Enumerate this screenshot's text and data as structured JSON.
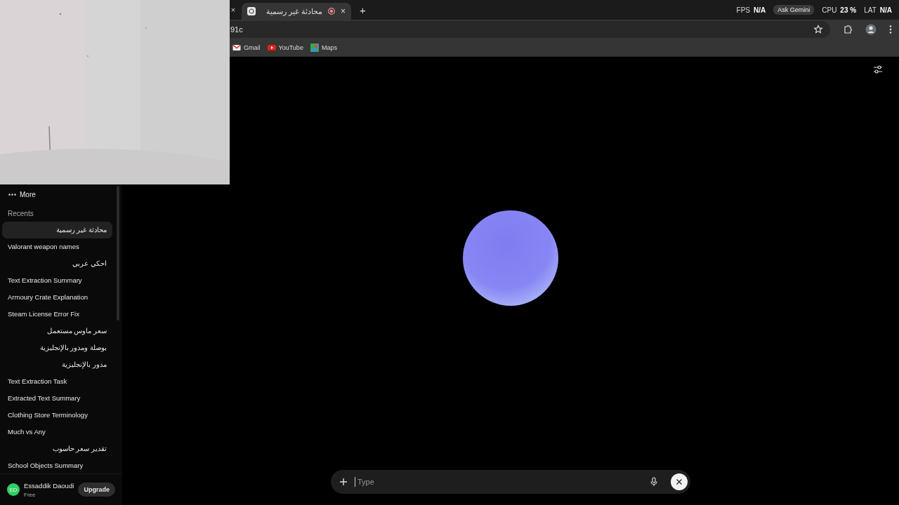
{
  "browser": {
    "prev_tab_close": "×",
    "tabs": [
      {
        "title": "محادثة غير رسمية",
        "recording": true,
        "selected": true,
        "close": "×"
      }
    ],
    "new_tab": "+",
    "address": "91c",
    "bookmarks": [
      {
        "kind": "gmail",
        "label": "Gmail"
      },
      {
        "kind": "youtube",
        "label": "YouTube"
      },
      {
        "kind": "maps",
        "label": "Maps"
      }
    ]
  },
  "overlay": {
    "stats": [
      {
        "label": "FPS",
        "value": "N/A"
      },
      {
        "label": "CPU",
        "value": "23 %"
      },
      {
        "label": "LAT",
        "value": "N/A"
      }
    ],
    "tooltip": "Ask Gemini"
  },
  "sidebar": {
    "more": "More",
    "recents_heading": "Recents",
    "recents": [
      {
        "title": "محادثة غير رسمية",
        "selected": true
      },
      {
        "title": "Valorant weapon names",
        "selected": false
      },
      {
        "title": "احكي عربي",
        "selected": false
      },
      {
        "title": "Text Extraction Summary",
        "selected": false
      },
      {
        "title": "Armoury Crate Explanation",
        "selected": false
      },
      {
        "title": "Steam License Error Fix",
        "selected": false
      },
      {
        "title": "سعر ماوس مستعمل",
        "selected": false
      },
      {
        "title": "بوصلة ومدور بالإنجليزية",
        "selected": false
      },
      {
        "title": "مدور بالإنجليزية",
        "selected": false
      },
      {
        "title": "Text Extraction Task",
        "selected": false
      },
      {
        "title": "Extracted Text Summary",
        "selected": false
      },
      {
        "title": "Clothing Store Terminology",
        "selected": false
      },
      {
        "title": "Much vs Any",
        "selected": false
      },
      {
        "title": "تقدير سعر حاسوب",
        "selected": false
      },
      {
        "title": "School Objects Summary",
        "selected": false
      }
    ],
    "user": {
      "initials": "ED",
      "name": "Essaddik Daoudi",
      "plan": "Free",
      "upgrade": "Upgrade"
    }
  },
  "composer": {
    "placeholder": "Type"
  }
}
